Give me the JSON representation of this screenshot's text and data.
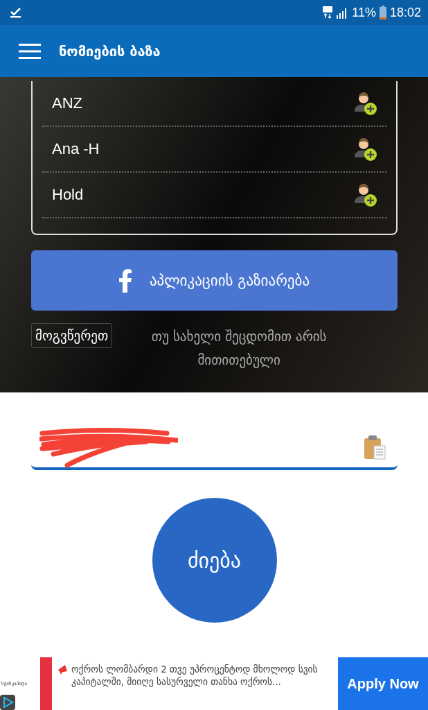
{
  "status_bar": {
    "battery": "11%",
    "time": "18:02"
  },
  "app_bar": {
    "title": "ნომიების ბაზა"
  },
  "names": [
    {
      "name": "ANZ"
    },
    {
      "name": "Ana -H"
    },
    {
      "name": "Hold"
    }
  ],
  "share_button": {
    "label": "აპლიკაციის გაზიარება"
  },
  "report": {
    "button": "მოგვწერეთ",
    "text": "თუ სახელი შეცდომით არის მითითებული"
  },
  "search_field": {
    "redacted": true
  },
  "search_button": {
    "label": "ძიება"
  },
  "ad": {
    "logo": "სვისკაპიტა",
    "text": "ოქროს ლომბარდი 2 თვე უპროცენტოდ მხოლოდ სვის კაპიტალში, მიიღე სასურველი თანხა ოქროს...",
    "cta": "Apply Now"
  }
}
